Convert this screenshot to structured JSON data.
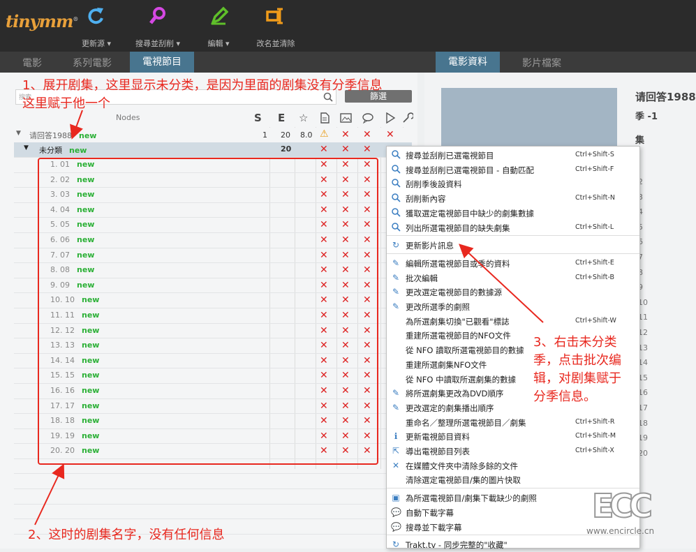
{
  "app": {
    "logo": "tinymm",
    "logo_mark": "®"
  },
  "toolbar": [
    {
      "name": "refresh",
      "label": "更新源 ▾",
      "color": "#4fb0f0"
    },
    {
      "name": "search",
      "label": "搜尋並刮削 ▾",
      "color": "#d548e3"
    },
    {
      "name": "edit",
      "label": "編輯 ▾",
      "color": "#5fbf2a"
    },
    {
      "name": "rename",
      "label": "改名並清除",
      "color": "#f09b1a"
    }
  ],
  "tabs": [
    "電影",
    "系列電影",
    "電視節目"
  ],
  "right_tabs": [
    "電影資料",
    "影片檔案"
  ],
  "search": {
    "placeholder": "搜索",
    "filter": "篩選"
  },
  "columns": {
    "nodes": "Nodes",
    "s": "S",
    "e": "E"
  },
  "show": {
    "title": "请回答1988",
    "badge": "new",
    "s": "1",
    "e": "20",
    "rating": "8.0"
  },
  "season": {
    "title": "未分類",
    "badge": "new",
    "e": "20"
  },
  "episodes": [
    "1. 01",
    "2. 02",
    "3. 03",
    "4. 04",
    "5. 05",
    "6. 06",
    "7. 07",
    "8. 08",
    "9. 09",
    "10. 10",
    "11. 11",
    "12. 12",
    "13. 13",
    "14. 14",
    "15. 15",
    "16. 16",
    "17. 17",
    "18. 18",
    "19. 19",
    "20. 20"
  ],
  "episode_badge": "new",
  "context_menu": [
    {
      "icon": "search",
      "label": "搜尋並刮削已選電視節目",
      "shortcut": "Ctrl+Shift-S"
    },
    {
      "icon": "search",
      "label": "搜尋並刮削已選電視節目 - 自動匹配",
      "shortcut": "Ctrl+Shift-F"
    },
    {
      "icon": "search",
      "label": "刮削季後設資料",
      "shortcut": ""
    },
    {
      "icon": "search",
      "label": "刮削新內容",
      "shortcut": "Ctrl+Shift-N"
    },
    {
      "icon": "search",
      "label": "獲取選定電視節目中缺少的劇集數據",
      "shortcut": ""
    },
    {
      "icon": "search",
      "label": "列出所選電視節目的缺失劇集",
      "shortcut": "Ctrl+Shift-L"
    },
    {
      "sep": true
    },
    {
      "icon": "refresh",
      "label": "更新影片訊息",
      "shortcut": ""
    },
    {
      "sep": true
    },
    {
      "icon": "edit",
      "label": "編輯所選電視節目或季的資料",
      "shortcut": "Ctrl+Shift-E"
    },
    {
      "icon": "edit",
      "label": "批次編輯",
      "shortcut": "Ctrl+Shift-B"
    },
    {
      "icon": "edit",
      "label": "更改選定電視節目的數據源",
      "shortcut": ""
    },
    {
      "icon": "edit",
      "label": "更改所選季的劇照",
      "shortcut": ""
    },
    {
      "icon": "",
      "label": "為所選劇集切換\"已觀看\"標誌",
      "shortcut": "Ctrl+Shift-W"
    },
    {
      "icon": "",
      "label": "重建所選電視節目的NFO文件",
      "shortcut": ""
    },
    {
      "icon": "",
      "label": "從 NFO 讀取所選電視節目的數據",
      "shortcut": ""
    },
    {
      "icon": "",
      "label": "重建所選劇集NFO文件",
      "shortcut": ""
    },
    {
      "icon": "",
      "label": "從 NFO 中讀取所選劇集的數據",
      "shortcut": ""
    },
    {
      "icon": "edit",
      "label": "將所選劇集更改為DVD順序",
      "shortcut": ""
    },
    {
      "icon": "edit",
      "label": "更改選定的劇集播出順序",
      "shortcut": ""
    },
    {
      "icon": "",
      "label": "重命名／整理所選電視節目／劇集",
      "shortcut": "Ctrl+Shift-R"
    },
    {
      "icon": "info",
      "label": "更新電視節目資料",
      "shortcut": "Ctrl+Shift-M"
    },
    {
      "icon": "export",
      "label": "導出電視節目列表",
      "shortcut": "Ctrl+Shift-X"
    },
    {
      "icon": "close",
      "label": "在媒體文件夾中清除多餘的文件",
      "shortcut": ""
    },
    {
      "icon": "",
      "label": "清除選定電視節目/集的圖片快取",
      "shortcut": ""
    },
    {
      "sep": true
    },
    {
      "icon": "image",
      "label": "為所選電視節目/劇集下載缺少的劇照",
      "shortcut": ""
    },
    {
      "icon": "chat",
      "label": "自動下載字幕",
      "shortcut": ""
    },
    {
      "icon": "chat",
      "label": "搜尋並下載字幕",
      "shortcut": ""
    },
    {
      "sep": true
    },
    {
      "icon": "refresh",
      "label": "Trakt.tv - 同步完整的\"收藏\"",
      "shortcut": ""
    }
  ],
  "right": {
    "title": "请回答1988",
    "season_label": "季",
    "season_value": "-1",
    "episodes_label": "集",
    "numbers": [
      "2",
      "3",
      "4",
      "5",
      "6",
      "7",
      "8",
      "9",
      "10",
      "11",
      "12",
      "13",
      "14",
      "15",
      "16",
      "17",
      "18",
      "19",
      "20"
    ]
  },
  "annotations": {
    "a1": "1、展开剧集，这里显示未分类，是因为里面的剧集没有分季信息",
    "a1b": "这里赋于他一个",
    "a2": "2、这时的剧集名字，没有任何信息",
    "a3": [
      "3、右击未分类",
      "季，点击批次编",
      "辑，对剧集赋于",
      "分季信息。"
    ]
  },
  "watermark": {
    "logo": "ECC",
    "url": "www.encircle.cn"
  }
}
